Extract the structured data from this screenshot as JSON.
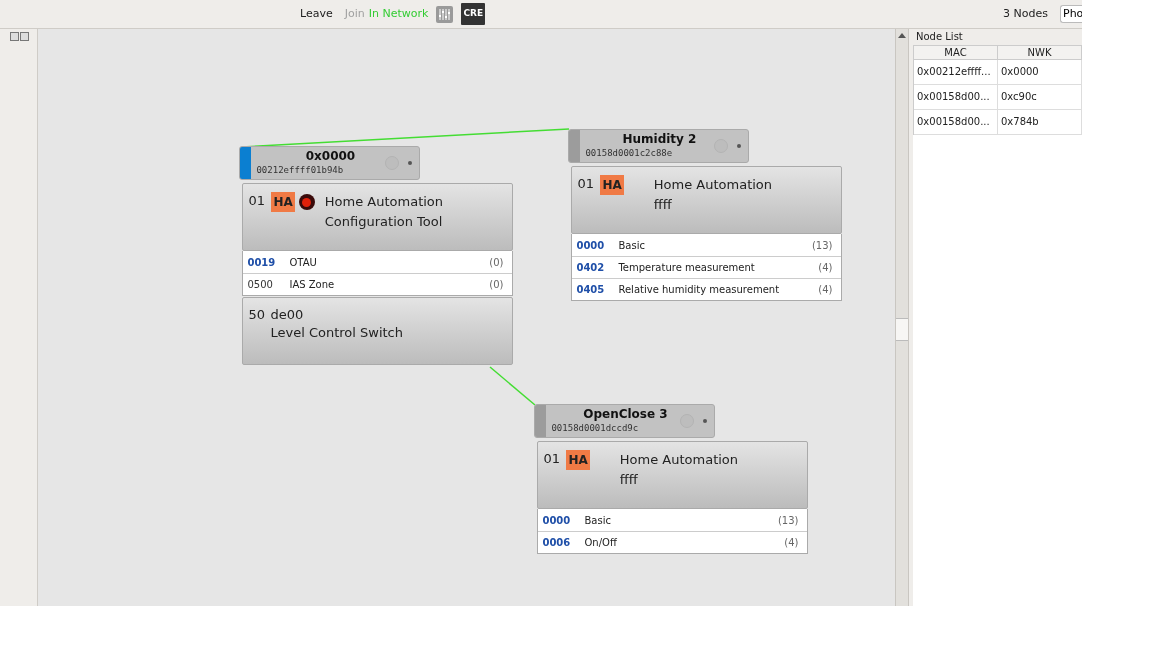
{
  "toolbar": {
    "actions": [
      {
        "label": "Leave",
        "disabled": false
      },
      {
        "label": "Join",
        "disabled": true
      }
    ],
    "status": "In Network",
    "badge": "CRE",
    "node_count": "3 Nodes",
    "view_select": "Pho"
  },
  "canvas": {
    "nodes": [
      {
        "title": "0x0000",
        "mac": "00212effff01b94b",
        "selected": true,
        "endpoints": [
          {
            "id": "01",
            "profile": "HA",
            "indicator": true,
            "lines": [
              "Home Automation",
              "Configuration Tool"
            ],
            "clusters": [
              {
                "id": "0019",
                "name": "OTAU",
                "count": "(0)",
                "highlighted": true
              },
              {
                "id": "0500",
                "name": "IAS Zone",
                "count": "(0)",
                "highlighted": false
              }
            ]
          },
          {
            "id": "50",
            "device": "de00",
            "lines": [
              "Level Control Switch"
            ]
          }
        ]
      },
      {
        "title": "Humidity 2",
        "mac": "00158d0001c2c88e",
        "selected": false,
        "endpoints": [
          {
            "id": "01",
            "profile": "HA",
            "indicator": false,
            "lines": [
              "Home Automation",
              "ffff"
            ],
            "clusters": [
              {
                "id": "0000",
                "name": "Basic",
                "count": "(13)",
                "highlighted": true
              },
              {
                "id": "0402",
                "name": "Temperature measurement",
                "count": "(4)",
                "highlighted": true
              },
              {
                "id": "0405",
                "name": "Relative humidity measurement",
                "count": "(4)",
                "highlighted": true
              }
            ]
          }
        ]
      },
      {
        "title": "OpenClose 3",
        "mac": "00158d0001dccd9c",
        "selected": false,
        "endpoints": [
          {
            "id": "01",
            "profile": "HA",
            "indicator": false,
            "lines": [
              "Home Automation",
              "ffff"
            ],
            "clusters": [
              {
                "id": "0000",
                "name": "Basic",
                "count": "(13)",
                "highlighted": true
              },
              {
                "id": "0006",
                "name": "On/Off",
                "count": "(4)",
                "highlighted": true
              }
            ]
          }
        ]
      }
    ]
  },
  "node_list": {
    "title": "Node List",
    "columns": [
      "MAC",
      "NWK"
    ],
    "rows": [
      [
        "0x00212effff...",
        "0x0000"
      ],
      [
        "0x00158d00...",
        "0xc90c"
      ],
      [
        "0x00158d00...",
        "0x784b"
      ]
    ]
  }
}
